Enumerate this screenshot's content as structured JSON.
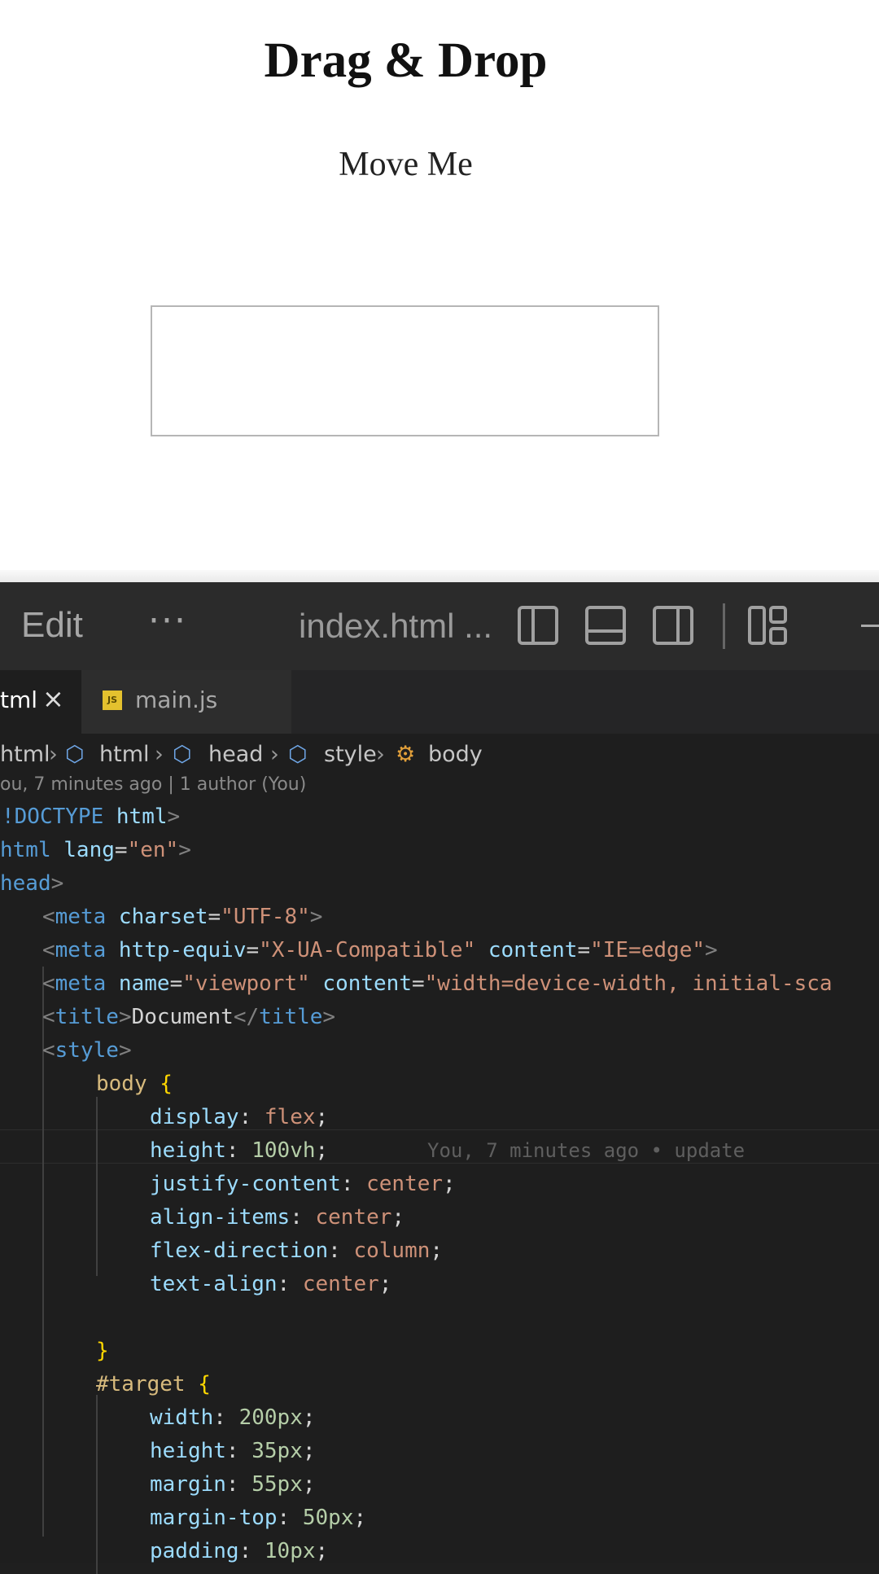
{
  "preview": {
    "title": "Drag & Drop",
    "draggable_text": "Move Me"
  },
  "editor": {
    "menu": {
      "edit_label": "Edit",
      "more_label": "···"
    },
    "window_title": "index.html ...",
    "tabs": [
      {
        "label": "tml",
        "close": "×",
        "active": true
      },
      {
        "label": "main.js",
        "icon": "js-file-icon",
        "active": false
      }
    ],
    "breadcrumb": [
      "html",
      "html",
      "head",
      "style",
      "body"
    ],
    "blame": "ou, 7 minutes ago | 1 author (You)",
    "inline_blame": "You, 7 minutes ago • update",
    "code": {
      "l1": {
        "a": "!DOCTYPE",
        "b": " html",
        "c": ">"
      },
      "l2": {
        "a": "html",
        "b": " lang",
        "c": "=",
        "d": "\"en\"",
        "e": ">"
      },
      "l3": {
        "a": "head",
        "b": ">"
      },
      "l4": {
        "a": "<",
        "b": "meta",
        "c": " charset",
        "d": "=",
        "e": "\"UTF-8\"",
        "f": ">"
      },
      "l5": {
        "a": "<",
        "b": "meta",
        "c": " http-equiv",
        "d": "=",
        "e": "\"X-UA-Compatible\"",
        "f": " content",
        "g": "=",
        "h": "\"IE=edge\"",
        "i": ">"
      },
      "l6": {
        "a": "<",
        "b": "meta",
        "c": " name",
        "d": "=",
        "e": "\"viewport\"",
        "f": " content",
        "g": "=",
        "h": "\"width=device-width, initial-sca"
      },
      "l7": {
        "a": "<",
        "b": "title",
        "c": ">",
        "d": "Document",
        "e": "</",
        "f": "title",
        "g": ">"
      },
      "l8": {
        "a": "<",
        "b": "style",
        "c": ">"
      },
      "l9": {
        "a": "body",
        "b": " {"
      },
      "l10": {
        "a": "display",
        "b": ": ",
        "c": "flex",
        "d": ";"
      },
      "l11": {
        "a": "height",
        "b": ": ",
        "c": "100vh",
        "d": ";"
      },
      "l12": {
        "a": "justify-content",
        "b": ": ",
        "c": "center",
        "d": ";"
      },
      "l13": {
        "a": "align-items",
        "b": ": ",
        "c": "center",
        "d": ";"
      },
      "l14": {
        "a": "flex-direction",
        "b": ": ",
        "c": "column",
        "d": ";"
      },
      "l15": {
        "a": "text-align",
        "b": ": ",
        "c": "center",
        "d": ";"
      },
      "l17": {
        "a": "}"
      },
      "l18": {
        "a": "#target",
        "b": " {"
      },
      "l19": {
        "a": "width",
        "b": ": ",
        "c": "200px",
        "d": ";"
      },
      "l20": {
        "a": "height",
        "b": ": ",
        "c": "35px",
        "d": ";"
      },
      "l21": {
        "a": "margin",
        "b": ": ",
        "c": "55px",
        "d": ";"
      },
      "l22": {
        "a": "margin-top",
        "b": ": ",
        "c": "50px",
        "d": ";"
      },
      "l23": {
        "a": "padding",
        "b": ": ",
        "c": "10px",
        "d": ";"
      }
    }
  }
}
